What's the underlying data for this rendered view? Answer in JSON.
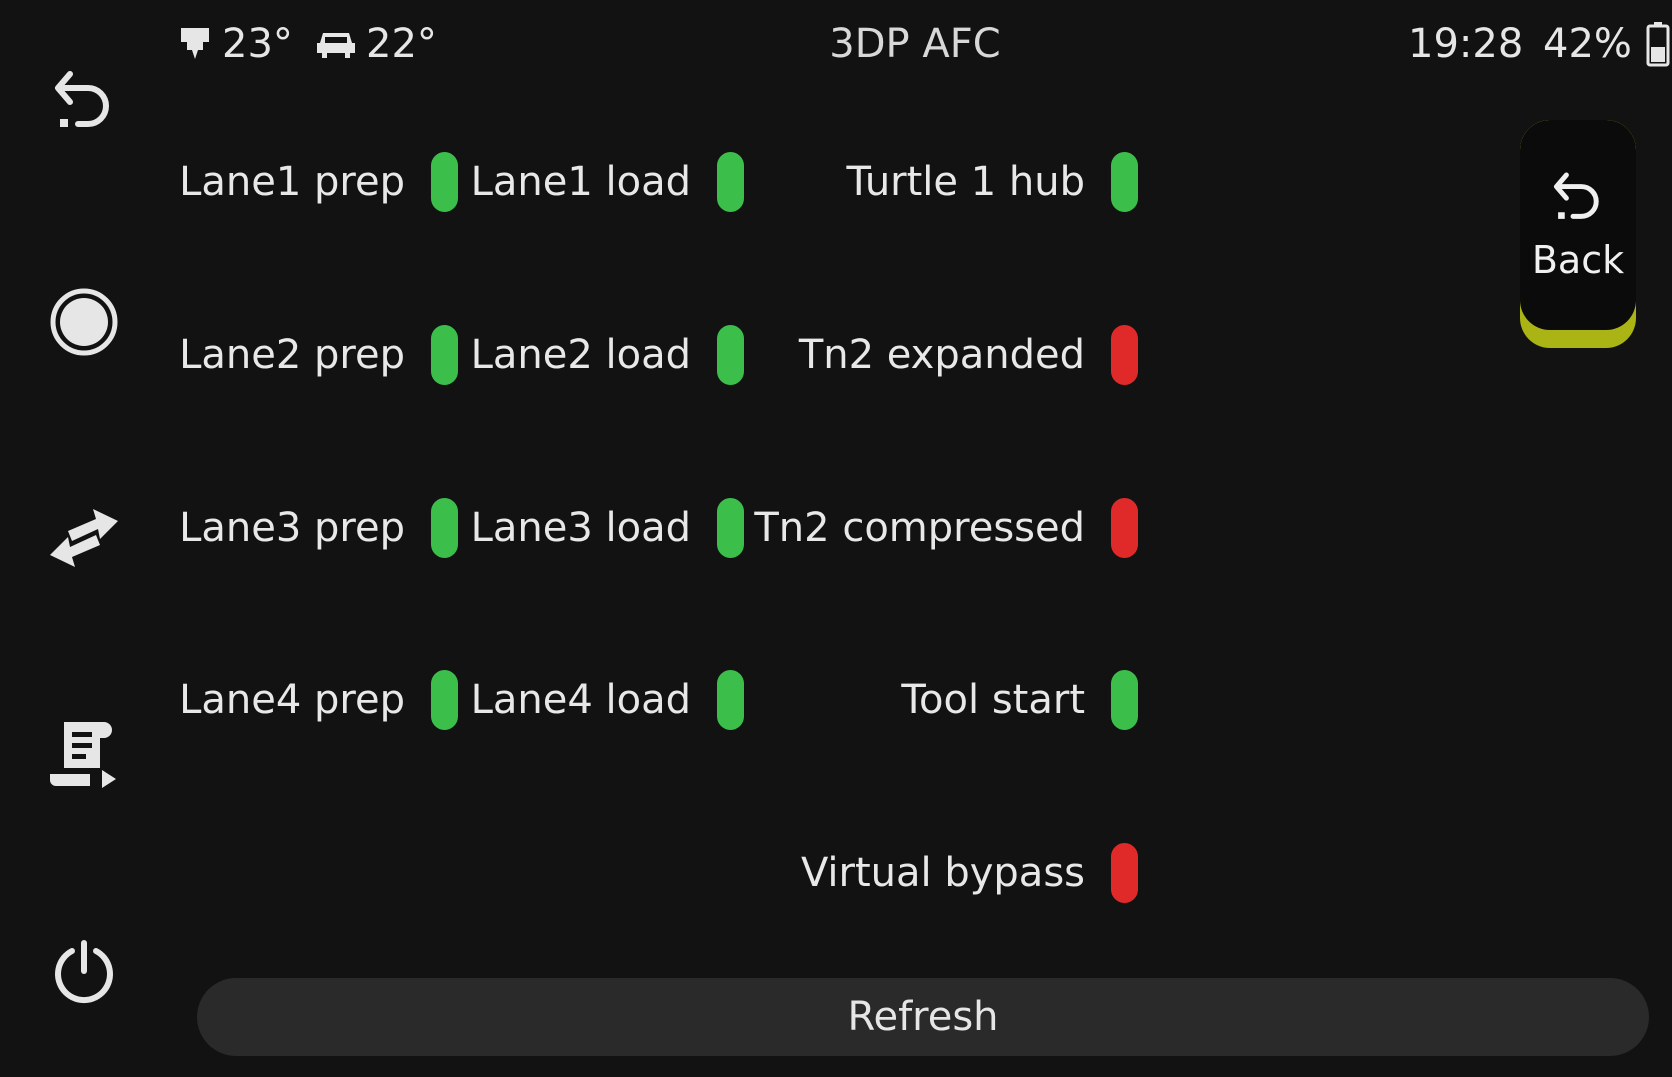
{
  "status_bar": {
    "extruder_temp": "23°",
    "extruder_icon": "extruder-icon",
    "bed_temp": "22°",
    "bed_icon": "heated-bed-icon",
    "title": "3DP AFC",
    "time": "19:28",
    "battery": "42%",
    "battery_icon": "battery-icon",
    "battery_level": 0.42
  },
  "nav": {
    "items": [
      {
        "icon": "back-arrow-icon"
      },
      {
        "icon": "home-circle-icon"
      },
      {
        "icon": "move-arrows-icon"
      },
      {
        "icon": "macros-icon"
      },
      {
        "icon": "power-icon"
      }
    ]
  },
  "sensors": {
    "prep": [
      {
        "label": "Lane1 prep",
        "state": "on"
      },
      {
        "label": "Lane2 prep",
        "state": "on"
      },
      {
        "label": "Lane3 prep",
        "state": "on"
      },
      {
        "label": "Lane4 prep",
        "state": "on"
      }
    ],
    "load": [
      {
        "label": "Lane1 load",
        "state": "on"
      },
      {
        "label": "Lane2 load",
        "state": "on"
      },
      {
        "label": "Lane3 load",
        "state": "on"
      },
      {
        "label": "Lane4 load",
        "state": "on"
      }
    ],
    "hub": [
      {
        "label": "Turtle 1 hub",
        "state": "on"
      },
      {
        "label": "Tn2 expanded",
        "state": "off"
      },
      {
        "label": "Tn2 compressed",
        "state": "off"
      },
      {
        "label": "Tool start",
        "state": "on"
      },
      {
        "label": "Virtual bypass",
        "state": "off"
      }
    ]
  },
  "back_button": {
    "label": "Back",
    "icon": "back-arrow-icon"
  },
  "refresh_button": {
    "label": "Refresh"
  },
  "colors": {
    "background": "#121212",
    "led_on": "#3cbe4a",
    "led_off": "#e02a2a",
    "accent": "#aab414",
    "button": "#2a2a2a"
  }
}
